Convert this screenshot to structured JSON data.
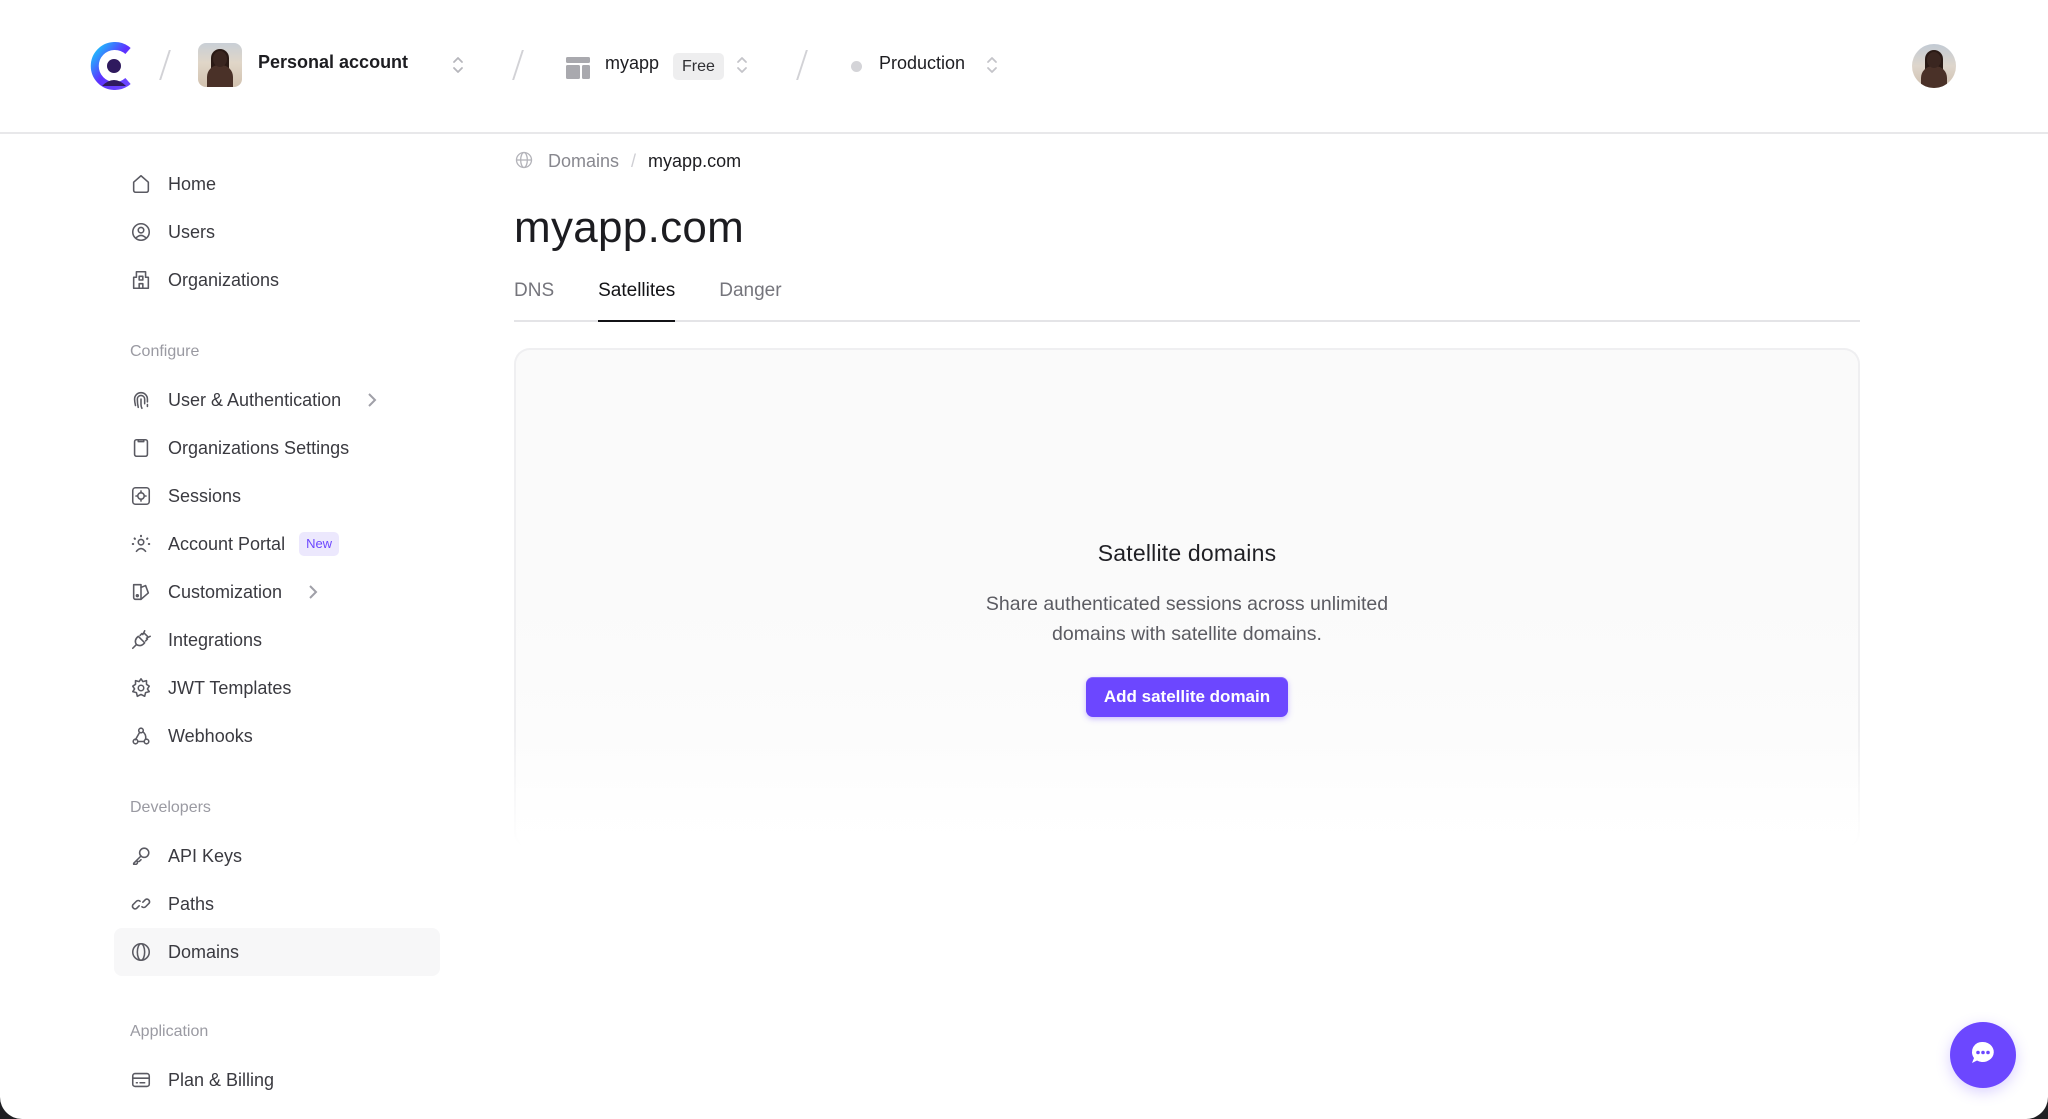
{
  "topbar": {
    "logo_icon": "clerk-logo-icon",
    "account": {
      "label": "Personal account",
      "icon": "account-avatar",
      "switch_icon": "chevron-up-down-icon"
    },
    "application": {
      "label": "myapp",
      "badge": "Free",
      "icon": "application-layout-icon",
      "switch_icon": "chevron-up-down-icon"
    },
    "environment": {
      "label": "Production",
      "status_color": "#d4d4d8",
      "switch_icon": "chevron-up-down-icon"
    },
    "user_avatar": "user-avatar"
  },
  "sidebar": {
    "main_items": [
      {
        "label": "Home",
        "icon": "home-icon"
      },
      {
        "label": "Users",
        "icon": "user-circle-icon"
      },
      {
        "label": "Organizations",
        "icon": "building-icon"
      }
    ],
    "configure": {
      "title": "Configure",
      "items": [
        {
          "label": "User & Authentication",
          "icon": "fingerprint-icon",
          "has_submenu": true
        },
        {
          "label": "Organizations Settings",
          "icon": "clipboard-icon"
        },
        {
          "label": "Sessions",
          "icon": "sessions-gear-icon"
        },
        {
          "label": "Account Portal",
          "icon": "account-portal-icon",
          "badge": "New"
        },
        {
          "label": "Customization",
          "icon": "customization-icon",
          "has_submenu": true
        },
        {
          "label": "Integrations",
          "icon": "plug-icon"
        },
        {
          "label": "JWT Templates",
          "icon": "cog-icon"
        },
        {
          "label": "Webhooks",
          "icon": "webhook-icon"
        }
      ]
    },
    "developers": {
      "title": "Developers",
      "items": [
        {
          "label": "API Keys",
          "icon": "key-icon"
        },
        {
          "label": "Paths",
          "icon": "link-icon"
        },
        {
          "label": "Domains",
          "icon": "globe-icon",
          "active": true
        }
      ]
    },
    "application": {
      "title": "Application",
      "items": [
        {
          "label": "Plan & Billing",
          "icon": "credit-card-icon"
        }
      ]
    }
  },
  "main": {
    "breadcrumb": {
      "icon": "globe-icon",
      "parent": "Domains",
      "separator": "/",
      "current": "myapp.com"
    },
    "title": "myapp.com",
    "tabs": [
      {
        "label": "DNS",
        "active": false
      },
      {
        "label": "Satellites",
        "active": true
      },
      {
        "label": "Danger",
        "active": false
      }
    ],
    "empty_state": {
      "title": "Satellite domains",
      "description": "Share authenticated sessions across unlimited domains with satellite domains.",
      "button_label": "Add satellite domain"
    }
  },
  "chat": {
    "icon": "chat-bubble-icon"
  },
  "colors": {
    "accent": "#6c47ff",
    "badge_bg": "#ece8fd",
    "text": "#131316",
    "muted": "#88888f"
  }
}
